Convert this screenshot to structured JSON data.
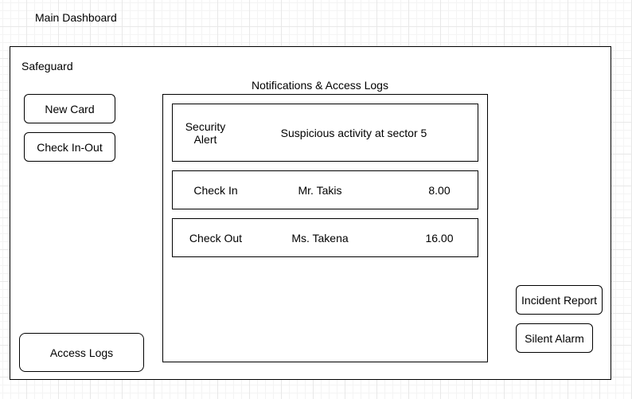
{
  "page": {
    "title": "Main Dashboard"
  },
  "app": {
    "name": "Safeguard"
  },
  "left_menu": {
    "new_card": "New Card",
    "check_in_out": "Check In-Out",
    "access_logs": "Access Logs"
  },
  "right_actions": {
    "incident_report": "Incident Report",
    "silent_alarm": "Silent Alarm"
  },
  "notifications": {
    "title": "Notifications & Access Logs",
    "alert": {
      "type": "Security Alert",
      "message": "Suspicious activity at sector 5"
    },
    "logs": [
      {
        "type": "Check In",
        "name": "Mr. Takis",
        "time": "8.00"
      },
      {
        "type": "Check Out",
        "name": "Ms. Takena",
        "time": "16.00"
      }
    ]
  }
}
